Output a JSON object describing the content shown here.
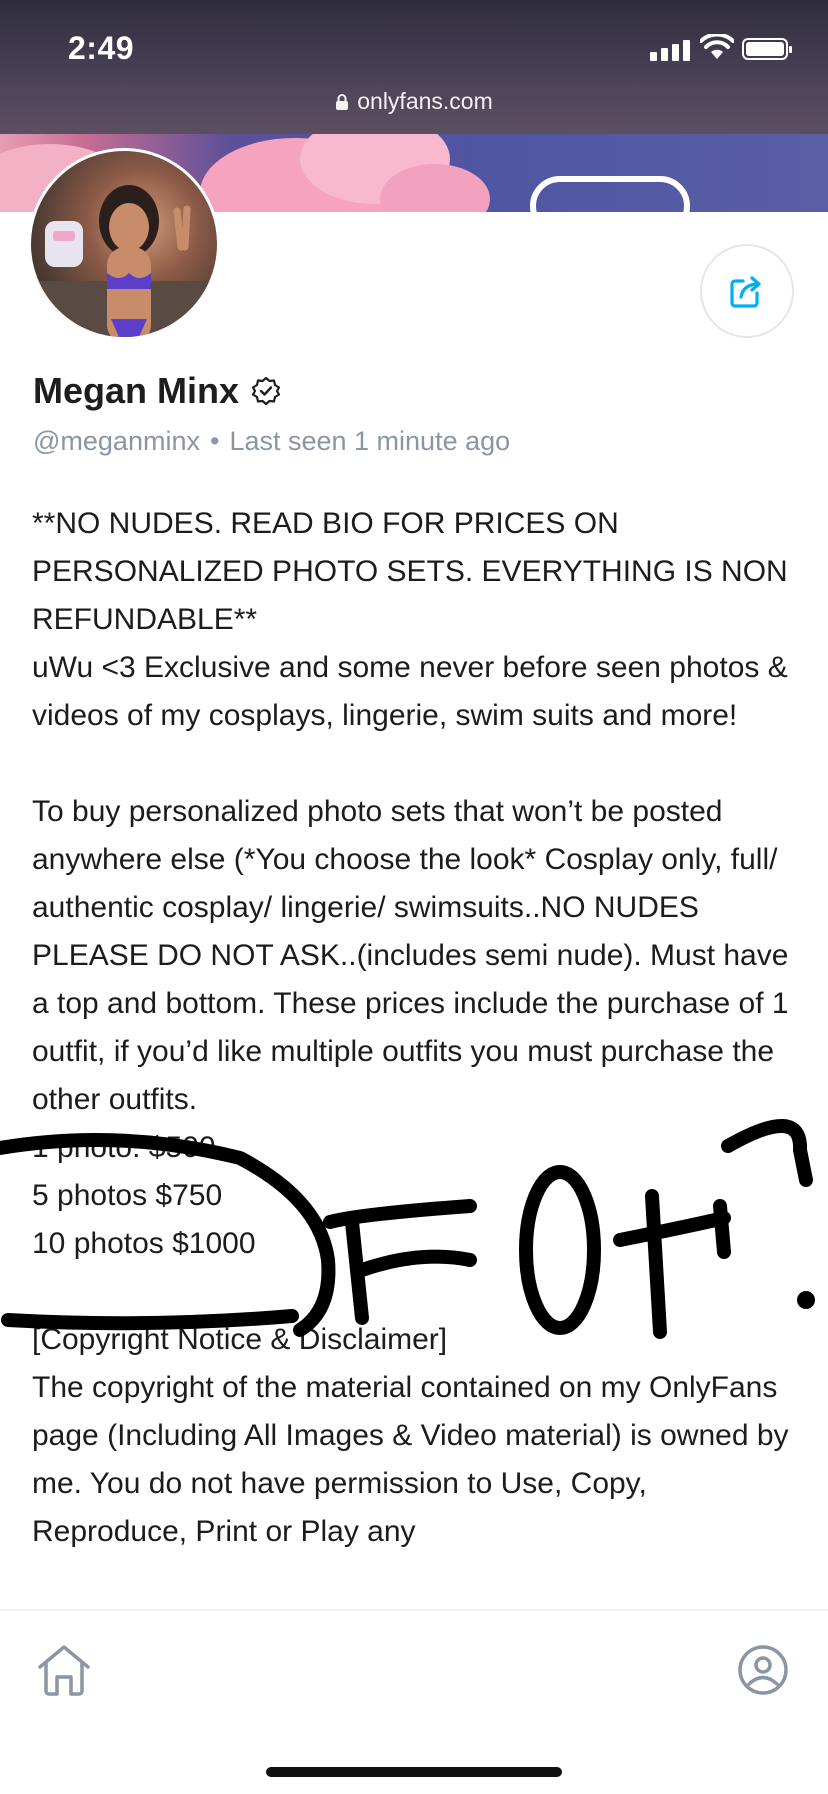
{
  "status_bar": {
    "time": "2:49",
    "url": "onlyfans.com"
  },
  "profile": {
    "name": "Megan Minx",
    "handle": "@meganminx",
    "separator": "•",
    "last_seen": "Last seen 1 minute ago"
  },
  "bio": {
    "p1": "**NO NUDES. READ BIO FOR PRICES ON PERSONALIZED PHOTO SETS. EVERYTHING IS NON REFUNDABLE**",
    "p2": "uWu <3 Exclusive and some never before seen photos & videos of my cosplays, lingerie, swim suits and more!",
    "p3": "To buy personalized photo sets that won’t be posted anywhere else (*You choose the look* Cosplay only, full/ authentic cosplay/ lingerie/ swimsuits..NO NUDES PLEASE DO NOT ASK..(includes semi nude). Must have a top and bottom. These prices include the purchase of 1 outfit, if you’d like multiple outfits you must purchase the other outfits.",
    "prices": [
      "1 photo: $500",
      "5 photos $750",
      "10 photos $1000"
    ],
    "copyright_heading": "[Copyright Notice & Disclaimer]",
    "copyright_text": "The copyright of the material contained on my OnlyFans page (Including All Images & Video material) is owned by me. You do not have permission to Use, Copy, Reproduce, Print or Play any"
  },
  "annotation": {
    "text": "FOH!",
    "color": "#000000"
  },
  "colors": {
    "accent": "#00aff0",
    "muted_text": "#8a96a3"
  },
  "icons": [
    "lock-icon",
    "verified-badge-icon",
    "share-icon",
    "home-icon",
    "profile-icon"
  ]
}
